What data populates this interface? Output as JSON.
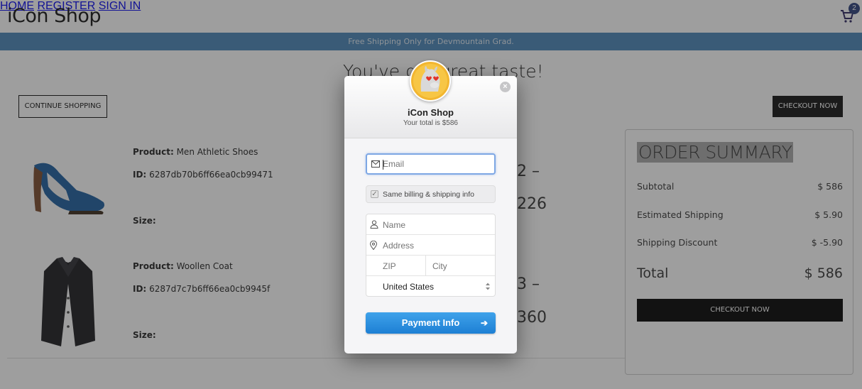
{
  "header": {
    "brand": "iCon Shop",
    "nav": [
      "HOME",
      "REGISTER",
      "SIGN IN"
    ],
    "cart_count": "2"
  },
  "banner": "Free Shipping Only for Devmountain Grad.",
  "headline": "You've got great taste!",
  "buttons": {
    "continue": "CONTINUE SHOPPING",
    "checkout_top": "CHECKOUT NOW"
  },
  "products": [
    {
      "product_label": "Product:",
      "product_name": "Men Athletic Shoes",
      "id_label": "ID:",
      "id": "6287db70b6ff66ea0cb99471",
      "size_label": "Size:",
      "peek_qty": "2 –",
      "peek_price": "226"
    },
    {
      "product_label": "Product:",
      "product_name": "Woollen Coat",
      "id_label": "ID:",
      "id": "6287d7c7b6ff66ea0cb9945f",
      "size_label": "Size:",
      "peek_qty": "3 –",
      "peek_price": "360"
    }
  ],
  "summary": {
    "title": "ORDER SUMMARY",
    "rows": [
      {
        "label": "Subtotal",
        "value": "$ 586"
      },
      {
        "label": "Estimated Shipping",
        "value": "$ 5.90"
      },
      {
        "label": "Shipping Discount",
        "value": "$ -5.90"
      }
    ],
    "total_label": "Total",
    "total_value": "$ 586",
    "checkout": "CHECKOUT NOW"
  },
  "modal": {
    "shop_name": "iCon Shop",
    "total_text": "Your total is $586",
    "email_placeholder": "Email",
    "same_info_label": "Same billing & shipping info",
    "name_placeholder": "Name",
    "address_placeholder": "Address",
    "zip_placeholder": "ZIP",
    "city_placeholder": "City",
    "country": "United States",
    "pay_button": "Payment Info"
  },
  "colors": {
    "banner": "#4a86b8",
    "pay_button": "#1d7fd4",
    "email_focus": "#7ea7e4"
  }
}
